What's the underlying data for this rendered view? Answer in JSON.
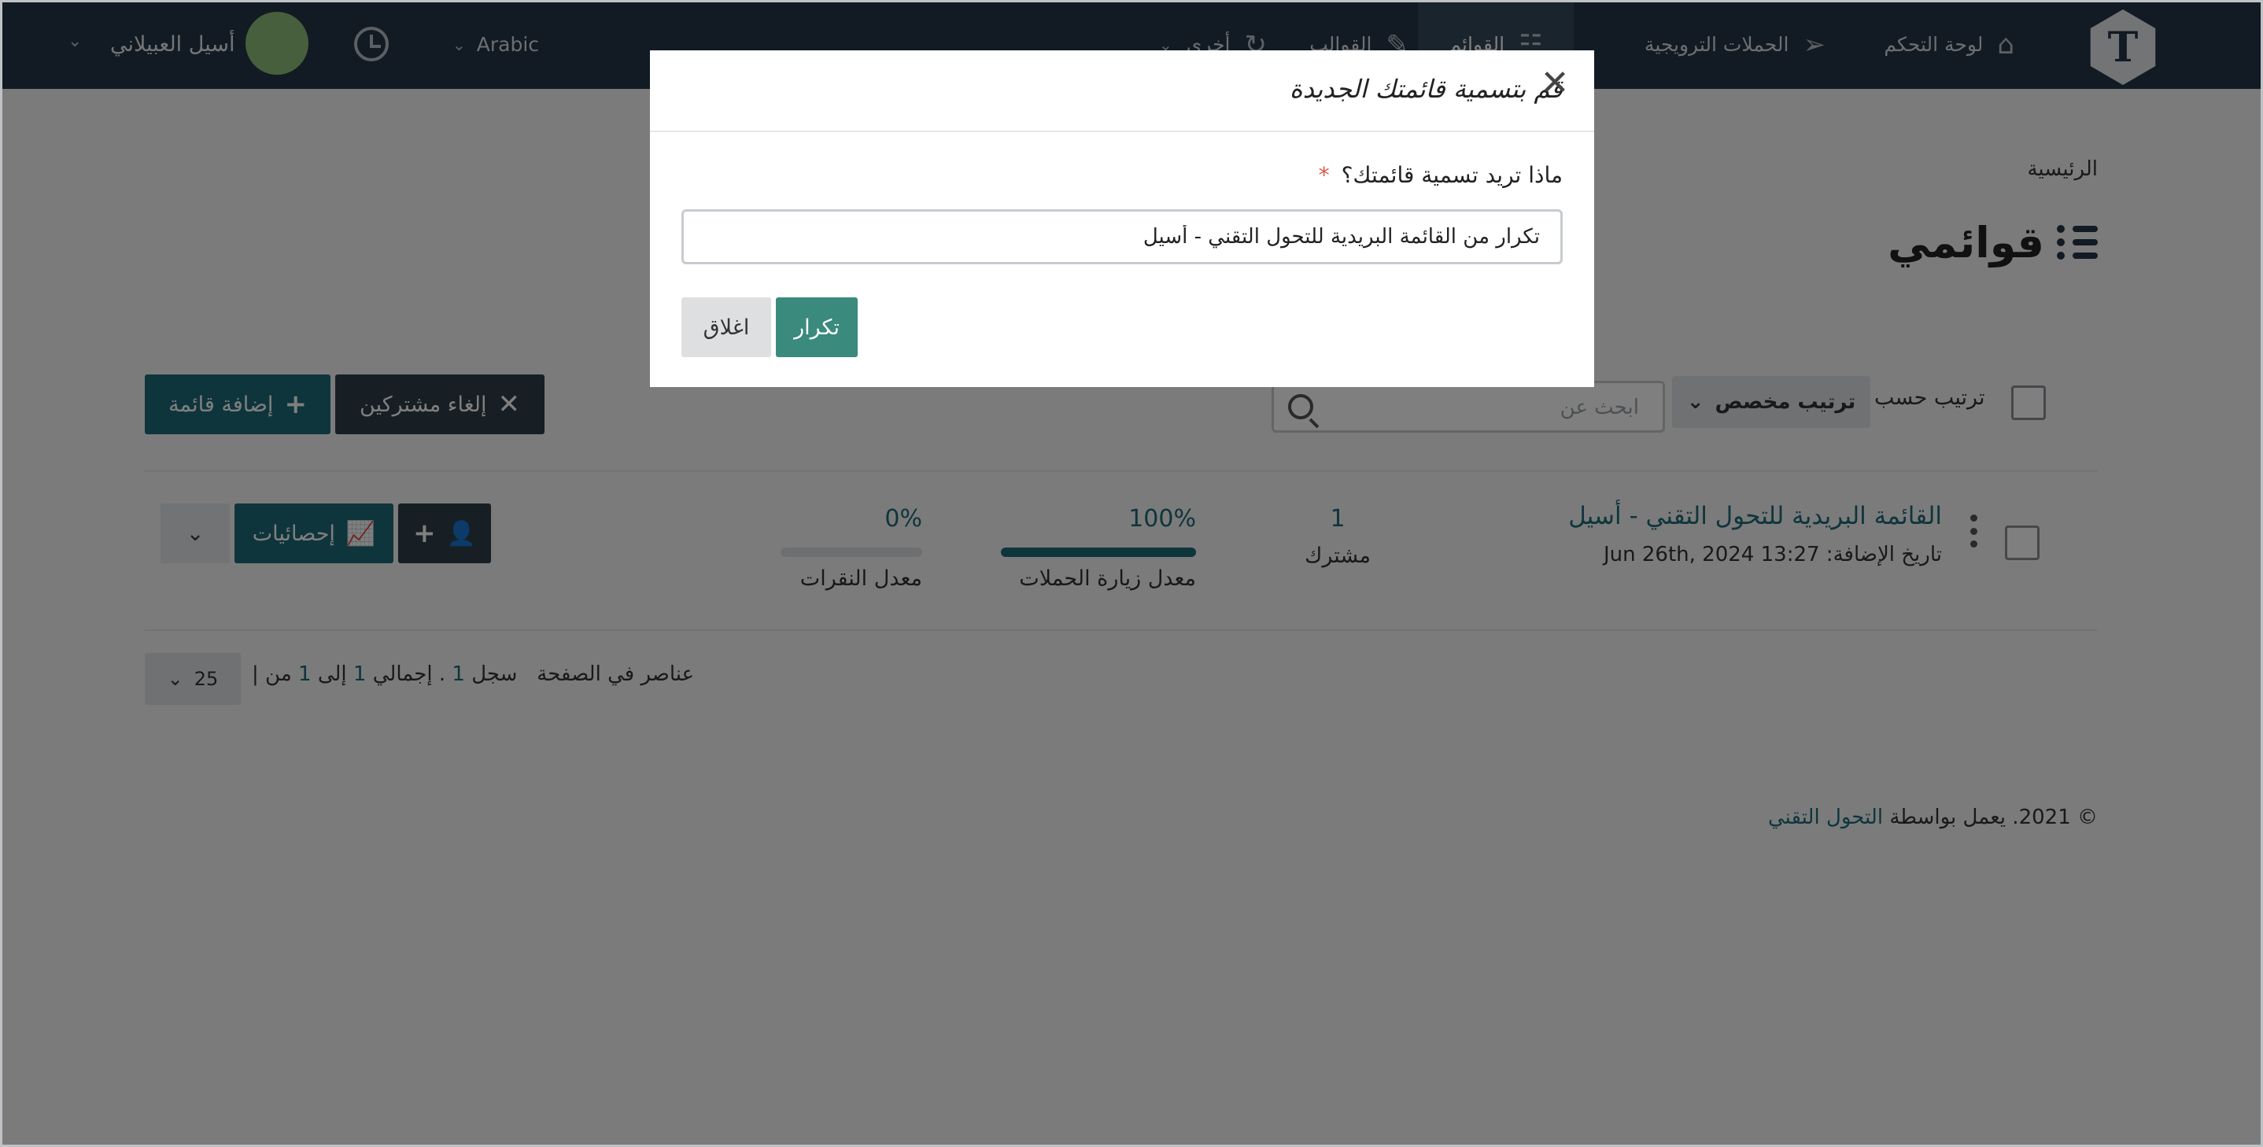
{
  "nav": {
    "dashboard": "لوحة التحكم",
    "campaigns": "الحملات الترويجية",
    "lists": "القوائم",
    "templates": "القوالب",
    "other": "أخرى",
    "language": "Arabic",
    "user_name": "أسيل العبيلاني",
    "logo_glyph": "T"
  },
  "page": {
    "breadcrumb": "الرئيسية",
    "title": "قوائمي",
    "sort_label": "ترتيب حسب",
    "sort_value": "ترتيب مخصص",
    "search_placeholder": "ابحث عن",
    "unsubscribe_button": "إلغاء مشتركين",
    "add_list_button": "إضافة قائمة"
  },
  "list_row": {
    "name": "القائمة البريدية للتحول التقني - أسيل",
    "date": "تاريخ الإضافة: Jun 26th, 2024 13:27",
    "subscribers_value": "1",
    "subscribers_label": "مشترك",
    "visit_rate_value": "100%",
    "visit_rate_label": "معدل زيارة الحملات",
    "visit_rate_fraction": 1.0,
    "click_rate_value": "0%",
    "click_rate_label": "معدل النقرات",
    "click_rate_fraction": 0.0,
    "stats_button": "إحصائيات"
  },
  "pagination": {
    "sep": "|",
    "from_text": "من",
    "from": "1",
    "to_text": "إلى",
    "to": "1",
    "total_text": ". إجمالي",
    "total": "1",
    "record_text": "سجل",
    "per_page_label": "عناصر في الصفحة",
    "per_page_value": "25"
  },
  "footer": {
    "prefix": "© 2021. يعمل بواسطة",
    "brand": "التحول التقني"
  },
  "modal": {
    "title": "قم بتسمية قائمتك الجديدة",
    "field_label": "ماذا تريد تسمية قائمتك؟",
    "required_mark": "*",
    "input_value": "تكرار من القائمة البريدية للتحول التقني - أسيل",
    "duplicate_button": "تكرار",
    "close_button": "اغلاق"
  },
  "icons": {
    "close": "✕",
    "plus": "+",
    "times": "✕",
    "caret": "⌄"
  },
  "colors": {
    "navbar": "#253746",
    "accent": "#1f6b79",
    "duplicate": "#3a8a7e"
  }
}
